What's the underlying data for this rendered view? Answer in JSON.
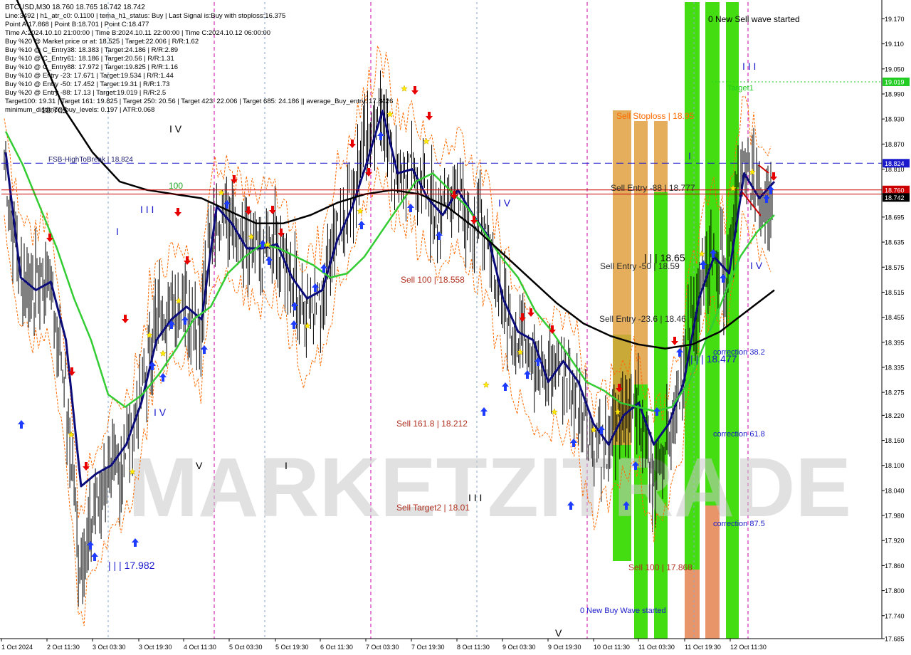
{
  "symbol_header": "BTCUSD,M30  18.760 18.765 18.742 18.742",
  "info_lines": [
    "Line:3492 | h1_atr_c0: 0.1100 | tema_h1_status: Buy | Last Signal is:Buy with stoploss:16.375",
    "Point A:17.868 | Point B:18.701 | Point C:18.477",
    "Time A:2024.10.10 21:00:00 | Time B:2024.10.11 22:00:00 | Time C:2024.10.12 06:00:00",
    "Buy %20 @ Market price or at: 18.525 | Target:22.006 | R/R:1.62",
    "Buy %10 @ C_Entry38: 18.383 | Target:24.186 | R/R:2.89",
    "Buy %10 @ C_Entry61: 18.186 | Target:20.56 | R/R:1.31",
    "Buy %10 @ C_Entry88: 17.972 | Target:19.825 | R/R:1.16",
    "Buy %10 @ Entry -23: 17.671 | Target:19.534 | R/R:1.44",
    "Buy %10 @ Entry -50: 17.452 | Target:19.31 | R/R:1.73",
    "Buy %20 @ Entry -88: 17.13 | Target:19.019 | R/R:2.5",
    "Target100: 19.31 | Target 161: 19.825 | Target 250: 20.56 | Target 423: 22.006 | Target 685: 24.186 || average_Buy_entry: 17.8426",
    "minimum_distance_buy_levels: 0.197 | ATR:0.068"
  ],
  "watermark": "MARKETZITRADE",
  "colors": {
    "background": "#ffffff",
    "bull_bar": "#000000",
    "ma_navy": "#0b0b7a",
    "ma_green": "#33cc33",
    "ma_black": "#000000",
    "orange_band": "#ff6a00",
    "buy_arrow": "#1e3cff",
    "sell_arrow": "#e80000",
    "zone_green": "#44dd11",
    "zone_orange": "#e0a040",
    "zone_salmon": "#e8956a",
    "blue_line": "#1a1acc",
    "red_line": "#cc0000",
    "tag_blue": "#1a1acc",
    "tag_black": "#000000",
    "tag_green": "#22cc22"
  },
  "chart_data": {
    "type": "candlestick",
    "ylim": [
      17.685,
      19.21
    ],
    "y_ticks": [
      "19.170",
      "19.110",
      "19.050",
      "18.990",
      "18.930",
      "18.870",
      "18.810",
      "18.750",
      "18.695",
      "18.635",
      "18.575",
      "18.515",
      "18.455",
      "18.395",
      "18.335",
      "18.275",
      "18.220",
      "18.160",
      "18.100",
      "18.040",
      "17.980",
      "17.920",
      "17.860",
      "17.800",
      "17.740",
      "17.685"
    ],
    "x_labels": [
      "1 Oct 2024",
      "2 Oct 11:30",
      "3 Oct 03:30",
      "3 Oct 19:30",
      "4 Oct 11:30",
      "5 Oct 03:30",
      "5 Oct 19:30",
      "6 Oct 11:30",
      "7 Oct 03:30",
      "7 Oct 19:30",
      "8 Oct 11:30",
      "9 Oct 03:30",
      "9 Oct 19:30",
      "10 Oct 11:30",
      "11 Oct 03:30",
      "11 Oct 19:30",
      "12 Oct 11:30"
    ],
    "price_tags": [
      {
        "label": "19.019",
        "value": 19.019,
        "color": "tag_green"
      },
      {
        "label": "18.824",
        "value": 18.824,
        "color": "tag_blue"
      },
      {
        "label": "18.760",
        "value": 18.76,
        "color": "red_line"
      },
      {
        "label": "18.742",
        "value": 18.742,
        "color": "tag_black"
      }
    ],
    "levels": [
      {
        "name": "FSB-HighToBreak | 18.824",
        "value": 18.824,
        "style": "blue-dashed"
      },
      {
        "name": "Target1",
        "value": 19.019,
        "style": "green-dotted"
      },
      {
        "name": "",
        "value": 18.76,
        "style": "red-solid"
      },
      {
        "name": "",
        "value": 18.75,
        "style": "red-solid"
      }
    ],
    "annotations": [
      {
        "text": "0 New Sell wave started",
        "color": "#000000"
      },
      {
        "text": "Sell Stoploss | 18.95",
        "color": "#ff6a00"
      },
      {
        "text": "Sell Entry -88 | 18.777",
        "color": "#2a2a2a"
      },
      {
        "text": "Sell Entry -50 | 18.59",
        "color": "#2a2a2a"
      },
      {
        "text": "Sell Entry -23.6 | 18.46",
        "color": "#2a2a2a"
      },
      {
        "text": "Sell 100 | 18.558",
        "color": "#b03020"
      },
      {
        "text": "Sell 161.8 | 18.212",
        "color": "#b03020"
      },
      {
        "text": "Sell Target2 | 18.01",
        "color": "#b03020"
      },
      {
        "text": "Sell 100 | 17.868",
        "color": "#b03020"
      },
      {
        "text": "0 New Buy Wave started",
        "color": "#1a1acc"
      },
      {
        "text": "correction 38.2",
        "color": "#1a1acc"
      },
      {
        "text": "correction 61.8",
        "color": "#1a1acc"
      },
      {
        "text": "correction 87.5",
        "color": "#1a1acc"
      },
      {
        "text": "| | | 18.477",
        "color": "#1a1acc"
      },
      {
        "text": "| | | 17.982",
        "color": "#1a1acc"
      },
      {
        "text": "| | | 18.65",
        "color": "#000000"
      },
      {
        "text": "18.705",
        "color": "#000000"
      },
      {
        "text": "100",
        "color": "#22aa22"
      },
      {
        "text": "Target1",
        "color": "#22cc22"
      }
    ],
    "wave_labels": [
      "I V",
      "I I I",
      "I",
      "I V",
      "V",
      "I",
      "I I I",
      "I V",
      "V",
      "I I I",
      "I",
      "I V"
    ],
    "series": [
      {
        "name": "",
        "values": [
          18.85,
          18.55,
          18.52,
          18.54,
          18.4,
          18.05,
          18.08,
          18.1,
          18.15,
          18.25,
          18.4,
          18.45,
          18.48,
          18.45,
          18.72,
          18.68,
          18.62,
          18.62,
          18.63,
          18.55,
          18.5,
          18.52,
          18.64,
          18.72,
          18.83,
          18.95,
          18.8,
          18.81,
          18.74,
          18.7,
          18.76,
          18.7,
          18.65,
          18.5,
          18.42,
          18.4,
          18.3,
          18.35,
          18.3,
          18.2,
          18.15,
          18.22,
          18.25,
          18.15,
          18.2,
          18.3,
          18.5,
          18.6,
          18.56,
          18.8,
          18.74,
          18.78
        ]
      },
      {
        "name": "",
        "values": [
          18.9,
          18.82,
          18.72,
          18.62,
          18.5,
          18.4,
          18.27,
          18.24,
          18.27,
          18.32,
          18.38,
          18.45,
          18.48,
          18.56,
          18.6,
          18.63,
          18.62,
          18.6,
          18.58,
          18.55,
          18.56,
          18.6,
          18.66,
          18.72,
          18.78,
          18.8,
          18.76,
          18.72,
          18.66,
          18.6,
          18.55,
          18.47,
          18.42,
          18.36,
          18.3,
          18.28,
          18.25,
          18.24,
          18.23,
          18.24,
          18.3,
          18.4,
          18.5,
          18.6,
          18.66,
          18.7
        ]
      },
      {
        "name": "",
        "values": [
          19.25,
          19.1,
          18.95,
          18.85,
          18.78,
          18.76,
          18.75,
          18.74,
          18.71,
          18.68,
          18.68,
          18.7,
          18.73,
          18.75,
          18.76,
          18.75,
          18.72,
          18.67,
          18.61,
          18.55,
          18.49,
          18.44,
          18.41,
          18.39,
          18.38,
          18.39,
          18.42,
          18.47,
          18.52
        ]
      }
    ]
  }
}
